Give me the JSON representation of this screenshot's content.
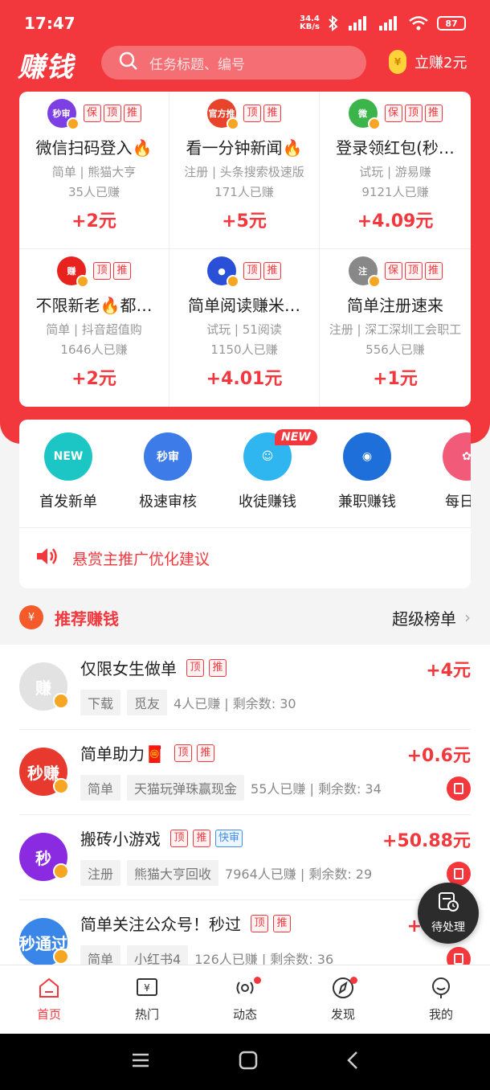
{
  "status_bar": {
    "time": "17:47",
    "speed_top": "34.4",
    "speed_bottom": "KB/s",
    "battery": "87"
  },
  "header": {
    "logo": "赚钱",
    "search_placeholder": "任务标题、编号",
    "earn_now": "立赚2元"
  },
  "featured": [
    {
      "icon_text": "秒审",
      "icon_color": "#7b3fe4",
      "tags": [
        "保",
        "顶",
        "推"
      ],
      "title": "微信扫码登入🔥",
      "sub": "简单 | 熊猫大亨",
      "count": "35人已赚",
      "price": "+2元"
    },
    {
      "icon_text": "官方推",
      "icon_color": "#e8442c",
      "tags": [
        "顶",
        "推"
      ],
      "title": "看一分钟新闻🔥",
      "sub": "注册 | 头条搜索极速版",
      "count": "171人已赚",
      "price": "+5元"
    },
    {
      "icon_text": "微",
      "icon_color": "#3bb54a",
      "tags": [
        "保",
        "顶",
        "推"
      ],
      "title": "登录领红包(秒…",
      "sub": "试玩 | 游易赚",
      "count": "9121人已赚",
      "price": "+4.09元"
    },
    {
      "icon_text": "赚",
      "icon_color": "#e8231f",
      "tags": [
        "顶",
        "推"
      ],
      "title": "不限新老🔥都…",
      "sub": "简单 | 抖音超值购",
      "count": "1646人已赚",
      "price": "+2元"
    },
    {
      "icon_text": "●",
      "icon_color": "#2b50d8",
      "tags": [
        "顶",
        "推"
      ],
      "title": "简单阅读赚米…",
      "sub": "试玩 | 51阅读",
      "count": "1150人已赚",
      "price": "+4.01元"
    },
    {
      "icon_text": "注",
      "icon_color": "#888888",
      "tags": [
        "保",
        "顶",
        "推"
      ],
      "title": "简单注册速来",
      "sub": "注册 | 深工深圳工会职工",
      "count": "556人已赚",
      "price": "+1元"
    }
  ],
  "categories": [
    {
      "label": "首发新单",
      "icon_text": "NEW",
      "color": "#1cc6c4"
    },
    {
      "label": "极速审核",
      "icon_text": "秒审",
      "color": "#3d7be8"
    },
    {
      "label": "收徒赚钱",
      "icon_text": "☺",
      "color": "#2fb6f0"
    },
    {
      "label": "兼职赚钱",
      "icon_text": "◉",
      "color": "#1e6fd9"
    },
    {
      "label": "每日签",
      "icon_text": "✿",
      "color": "#f25a7a"
    }
  ],
  "new_badge": "NEW",
  "notice": "悬赏主推广优化建议",
  "recommend": {
    "title": "推荐赚钱",
    "more": "超级榜单"
  },
  "tasks": [
    {
      "avatar_text": "赚",
      "avatar_color": "#e2e2e2",
      "title": "仅限女生做单",
      "tags": [
        "顶",
        "推"
      ],
      "chips": [
        "下载",
        "觅友"
      ],
      "stats": "4人已赚 | 剩余数: 30",
      "price": "+4元",
      "redbag": false
    },
    {
      "avatar_text": "秒赚",
      "avatar_color": "#e8392f",
      "title": "简单助力🧧",
      "tags": [
        "顶",
        "推"
      ],
      "chips": [
        "简单",
        "天猫玩弹珠赢现金"
      ],
      "stats": "55人已赚 | 剩余数: 34",
      "price": "+0.6元",
      "redbag": true
    },
    {
      "avatar_text": "秒",
      "avatar_color": "#8a2be2",
      "title": "搬砖小游戏",
      "tags": [
        "顶",
        "推"
      ],
      "blue_tag": "快审",
      "chips": [
        "注册",
        "熊猫大亨回收"
      ],
      "stats": "7964人已赚 | 剩余数: 29",
      "price": "+50.88元",
      "redbag": true
    },
    {
      "avatar_text": "秒通过",
      "avatar_color": "#3a86e8",
      "title": "简单关注公众号！秒过",
      "tags": [
        "顶",
        "推"
      ],
      "chips": [
        "简单",
        "小红书4"
      ],
      "stats": "126人已赚 | 剩余数: 36",
      "price": "+1.5元",
      "redbag": true
    }
  ],
  "pending": "待处理",
  "nav": [
    {
      "label": "首页"
    },
    {
      "label": "热门"
    },
    {
      "label": "动态"
    },
    {
      "label": "发现"
    },
    {
      "label": "我的"
    }
  ]
}
